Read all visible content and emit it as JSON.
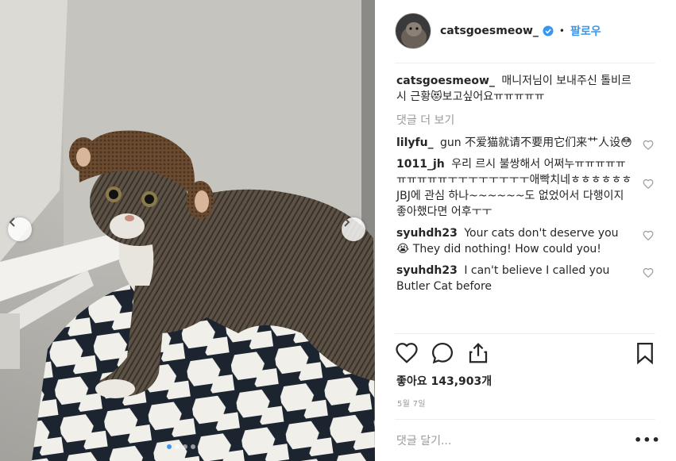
{
  "post": {
    "username": "catsgoesmeow_",
    "separator": "•",
    "follow_label": "팔로우",
    "caption_text": "매니저님이 보내주신 톨비르시 근황😻보고싶어요ㅠㅠㅠㅠㅠ",
    "view_more_comments": "댓글 더 보기",
    "comments": [
      {
        "user": "lilyfu_",
        "text": "gun 不爱猫就请不要用它们来艹人设😳"
      },
      {
        "user": "1011_jh",
        "text": "우리 르시 불쌍해서 어쩌누ㅠㅠㅠㅠㅠㅠㅠㅠㅠㅠㅜㅜㅜㅜㅜㅜㅜㅜ애빡치네ㅎㅎㅎㅎㅎㅎJBJ에 관심 하나~~~~~~도 없었어서 다행이지 좋아했다면 어후ㅜㅜ"
      },
      {
        "user": "syuhdh23",
        "text": "Your cats don't deserve you 😭 They did nothing! How could you!"
      },
      {
        "user": "syuhdh23",
        "text": "I can't believe I called you Butler Cat before"
      }
    ],
    "likes": "좋아요 143,903개",
    "date": "5월 7일",
    "add_comment_placeholder": "댓글 달기...",
    "more_options": "•••"
  },
  "carousel": {
    "count": 4,
    "active_index": 0
  },
  "colors": {
    "accent": "#3897f0",
    "text": "#262626",
    "muted": "#999999",
    "divider": "#efefef"
  },
  "icons": {
    "like": "heart-icon",
    "comment": "comment-icon",
    "share": "share-icon",
    "save": "bookmark-icon",
    "verified": "verified-badge-icon",
    "prev": "chevron-left-icon",
    "next": "chevron-right-icon"
  }
}
